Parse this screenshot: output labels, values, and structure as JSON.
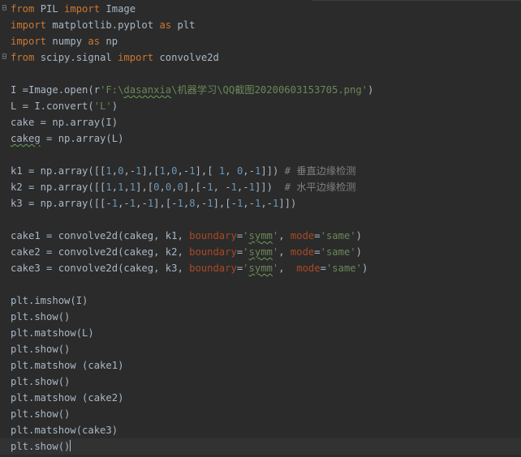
{
  "editor": {
    "lines": [
      {
        "segments": [
          {
            "t": "from",
            "c": "kw"
          },
          {
            "t": " PIL "
          },
          {
            "t": "import",
            "c": "kw"
          },
          {
            "t": " Image"
          }
        ]
      },
      {
        "segments": [
          {
            "t": "import",
            "c": "kw"
          },
          {
            "t": " matplotlib.pyplot "
          },
          {
            "t": "as",
            "c": "kw"
          },
          {
            "t": " plt"
          }
        ]
      },
      {
        "segments": [
          {
            "t": "import",
            "c": "kw"
          },
          {
            "t": " numpy "
          },
          {
            "t": "as",
            "c": "kw"
          },
          {
            "t": " np"
          }
        ]
      },
      {
        "segments": [
          {
            "t": "from",
            "c": "kw"
          },
          {
            "t": " scipy.signal "
          },
          {
            "t": "import",
            "c": "kw"
          },
          {
            "t": " convolve2d"
          }
        ]
      },
      {
        "segments": []
      },
      {
        "segments": [
          {
            "t": "I =Image.open(r"
          },
          {
            "t": "'F:\\",
            "c": "str"
          },
          {
            "t": "dasanxia",
            "c": "str typo"
          },
          {
            "t": "\\机器学习\\QQ截图20200603153705.png'",
            "c": "str"
          },
          {
            "t": ")"
          }
        ]
      },
      {
        "segments": [
          {
            "t": "L = I.convert("
          },
          {
            "t": "'L'",
            "c": "str"
          },
          {
            "t": ")"
          }
        ]
      },
      {
        "segments": [
          {
            "t": "cake = np.array(I)"
          }
        ]
      },
      {
        "segments": [
          {
            "t": "cakeg",
            "c": "typo"
          },
          {
            "t": " = np.array(L)"
          }
        ]
      },
      {
        "segments": []
      },
      {
        "segments": [
          {
            "t": "k1 = np.array([["
          },
          {
            "t": "1",
            "c": "num"
          },
          {
            "t": ","
          },
          {
            "t": "0",
            "c": "num"
          },
          {
            "t": ",-"
          },
          {
            "t": "1",
            "c": "num"
          },
          {
            "t": "],["
          },
          {
            "t": "1",
            "c": "num"
          },
          {
            "t": ","
          },
          {
            "t": "0",
            "c": "num"
          },
          {
            "t": ",-"
          },
          {
            "t": "1",
            "c": "num"
          },
          {
            "t": "],[ "
          },
          {
            "t": "1",
            "c": "num"
          },
          {
            "t": ", "
          },
          {
            "t": "0",
            "c": "num"
          },
          {
            "t": ",-"
          },
          {
            "t": "1",
            "c": "num"
          },
          {
            "t": "]]) "
          },
          {
            "t": "# 垂直边缘检测",
            "c": "cmt"
          }
        ]
      },
      {
        "segments": [
          {
            "t": "k2 = np.array([["
          },
          {
            "t": "1",
            "c": "num"
          },
          {
            "t": ","
          },
          {
            "t": "1",
            "c": "num"
          },
          {
            "t": ","
          },
          {
            "t": "1",
            "c": "num"
          },
          {
            "t": "],["
          },
          {
            "t": "0",
            "c": "num"
          },
          {
            "t": ","
          },
          {
            "t": "0",
            "c": "num"
          },
          {
            "t": ","
          },
          {
            "t": "0",
            "c": "num"
          },
          {
            "t": "],[-"
          },
          {
            "t": "1",
            "c": "num"
          },
          {
            "t": ", -"
          },
          {
            "t": "1",
            "c": "num"
          },
          {
            "t": ",-"
          },
          {
            "t": "1",
            "c": "num"
          },
          {
            "t": "]])  "
          },
          {
            "t": "# 水平边缘检测",
            "c": "cmt"
          }
        ]
      },
      {
        "segments": [
          {
            "t": "k3 = np.array([[-"
          },
          {
            "t": "1",
            "c": "num"
          },
          {
            "t": ",-"
          },
          {
            "t": "1",
            "c": "num"
          },
          {
            "t": ",-"
          },
          {
            "t": "1",
            "c": "num"
          },
          {
            "t": "],[-"
          },
          {
            "t": "1",
            "c": "num"
          },
          {
            "t": ","
          },
          {
            "t": "8",
            "c": "num"
          },
          {
            "t": ",-"
          },
          {
            "t": "1",
            "c": "num"
          },
          {
            "t": "],[-"
          },
          {
            "t": "1",
            "c": "num"
          },
          {
            "t": ",-"
          },
          {
            "t": "1",
            "c": "num"
          },
          {
            "t": ",-"
          },
          {
            "t": "1",
            "c": "num"
          },
          {
            "t": "]])"
          }
        ]
      },
      {
        "segments": []
      },
      {
        "segments": [
          {
            "t": "cake1 = convolve2d(cakeg, k1, "
          },
          {
            "t": "boundary",
            "c": "param"
          },
          {
            "t": "="
          },
          {
            "t": "'",
            "c": "str"
          },
          {
            "t": "symm",
            "c": "str typo"
          },
          {
            "t": "'",
            "c": "str"
          },
          {
            "t": ", "
          },
          {
            "t": "mode",
            "c": "param"
          },
          {
            "t": "="
          },
          {
            "t": "'same'",
            "c": "str"
          },
          {
            "t": ")"
          }
        ]
      },
      {
        "segments": [
          {
            "t": "cake2 = convolve2d(cakeg, k2, "
          },
          {
            "t": "boundary",
            "c": "param"
          },
          {
            "t": "="
          },
          {
            "t": "'",
            "c": "str"
          },
          {
            "t": "symm",
            "c": "str typo"
          },
          {
            "t": "'",
            "c": "str"
          },
          {
            "t": ", "
          },
          {
            "t": "mode",
            "c": "param"
          },
          {
            "t": "="
          },
          {
            "t": "'same'",
            "c": "str"
          },
          {
            "t": ")"
          }
        ]
      },
      {
        "segments": [
          {
            "t": "cake3 = convolve2d(cakeg, k3, "
          },
          {
            "t": "boundary",
            "c": "param"
          },
          {
            "t": "="
          },
          {
            "t": "'",
            "c": "str"
          },
          {
            "t": "symm",
            "c": "str typo"
          },
          {
            "t": "'",
            "c": "str"
          },
          {
            "t": ",  "
          },
          {
            "t": "mode",
            "c": "param"
          },
          {
            "t": "="
          },
          {
            "t": "'same'",
            "c": "str"
          },
          {
            "t": ")"
          }
        ]
      },
      {
        "segments": []
      },
      {
        "segments": [
          {
            "t": "plt.imshow(I)"
          }
        ]
      },
      {
        "segments": [
          {
            "t": "plt.show()"
          }
        ]
      },
      {
        "segments": [
          {
            "t": "plt.matshow(L)"
          }
        ]
      },
      {
        "segments": [
          {
            "t": "plt.show()"
          }
        ]
      },
      {
        "segments": [
          {
            "t": "plt.matshow (cake1)"
          }
        ]
      },
      {
        "segments": [
          {
            "t": "plt.show()"
          }
        ]
      },
      {
        "segments": [
          {
            "t": "plt.matshow (cake2)"
          }
        ]
      },
      {
        "segments": [
          {
            "t": "plt.show()"
          }
        ]
      },
      {
        "segments": [
          {
            "t": "plt.matshow(cake3)"
          }
        ]
      },
      {
        "segments": [
          {
            "t": "plt.show()"
          }
        ]
      }
    ],
    "current_line": 28,
    "fold_lines": [
      1,
      4
    ],
    "colors": {
      "background": "#2b2b2b",
      "text": "#a9b7c6",
      "keyword": "#cc7832",
      "string": "#6a8759",
      "number": "#6897bb",
      "param": "#aa4926",
      "comment": "#808080",
      "current_line": "#323232"
    }
  }
}
